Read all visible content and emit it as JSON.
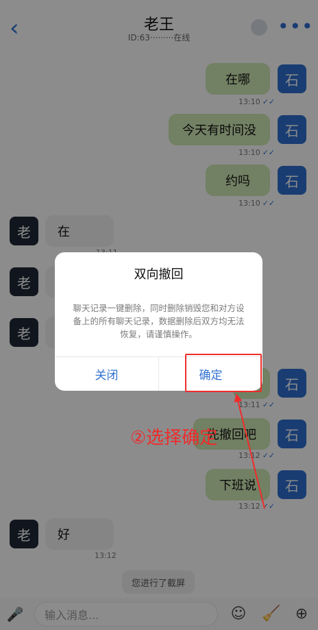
{
  "header": {
    "title": "老王",
    "subtitle": "ID:63·········在线"
  },
  "messages": [
    {
      "side": "me",
      "text": "在哪",
      "time": "13:10",
      "avatar": "石"
    },
    {
      "side": "me",
      "text": "今天有时间没",
      "time": "13:10",
      "avatar": "石"
    },
    {
      "side": "me",
      "text": "约吗",
      "time": "13:10",
      "avatar": "石"
    },
    {
      "side": "other",
      "text": "在",
      "time": "13:11",
      "avatar": "老"
    },
    {
      "side": "other",
      "text": "",
      "time": "",
      "avatar": "老"
    },
    {
      "side": "other",
      "text": "",
      "time": "",
      "avatar": "老"
    },
    {
      "side": "me",
      "text": "",
      "time": "13:11",
      "avatar": "石"
    },
    {
      "side": "me",
      "text": "先撤回吧",
      "time": "13:12",
      "avatar": "石"
    },
    {
      "side": "me",
      "text": "下班说",
      "time": "13:12",
      "avatar": "石"
    },
    {
      "side": "other",
      "text": "好",
      "time": "13:12",
      "avatar": "老"
    }
  ],
  "notice": "您进行了截屏",
  "input": {
    "placeholder": "输入消息..."
  },
  "modal": {
    "title": "双向撤回",
    "body": "聊天记录一键删除，同时删除销毁您和对方设备上的所有聊天记录，数据删除后双方均无法恢复，请谨慎操作。",
    "close_label": "关闭",
    "confirm_label": "确定"
  },
  "annotation": {
    "text": "②选择确定",
    "color": "#ef2b2b"
  },
  "colors": {
    "accent": "#2f6fd0",
    "my_bubble": "#cfe9b5",
    "other_bubble": "#f2f2f2"
  }
}
